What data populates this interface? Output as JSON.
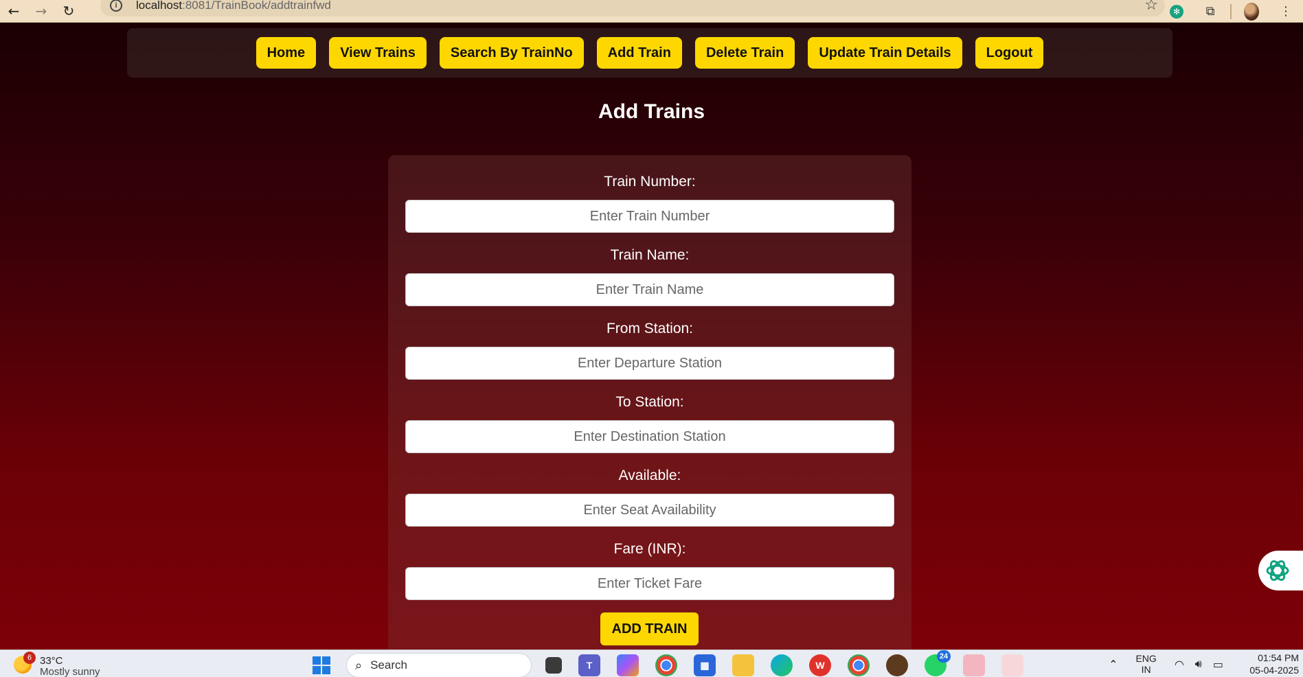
{
  "browser": {
    "url_host": "localhost",
    "url_path": ":8081/TrainBook/addtrainfwd"
  },
  "navbar": {
    "items": [
      {
        "label": "Home"
      },
      {
        "label": "View Trains"
      },
      {
        "label": "Search By TrainNo"
      },
      {
        "label": "Add Train"
      },
      {
        "label": "Delete Train"
      },
      {
        "label": "Update Train Details"
      },
      {
        "label": "Logout"
      }
    ]
  },
  "page": {
    "title": "Add Trains"
  },
  "form": {
    "fields": [
      {
        "label": "Train Number:",
        "placeholder": "Enter Train Number",
        "value": ""
      },
      {
        "label": "Train Name:",
        "placeholder": "Enter Train Name",
        "value": ""
      },
      {
        "label": "From Station:",
        "placeholder": "Enter Departure Station",
        "value": ""
      },
      {
        "label": "To Station:",
        "placeholder": "Enter Destination Station",
        "value": ""
      },
      {
        "label": "Available:",
        "placeholder": "Enter Seat Availability",
        "value": ""
      },
      {
        "label": "Fare (INR):",
        "placeholder": "Enter Ticket Fare",
        "value": ""
      }
    ],
    "submit_label": "ADD TRAIN"
  },
  "taskbar": {
    "weather_badge": "6",
    "weather_temp": "33°C",
    "weather_condition": "Mostly sunny",
    "search_placeholder": "Search",
    "whatsapp_badge": "24",
    "language": "ENG",
    "region": "IN",
    "time": "01:54 PM",
    "date": "05-04-2025"
  },
  "colors": {
    "accent": "#ffd700",
    "page_top": "#1a0003",
    "page_bottom": "#7d0008"
  }
}
